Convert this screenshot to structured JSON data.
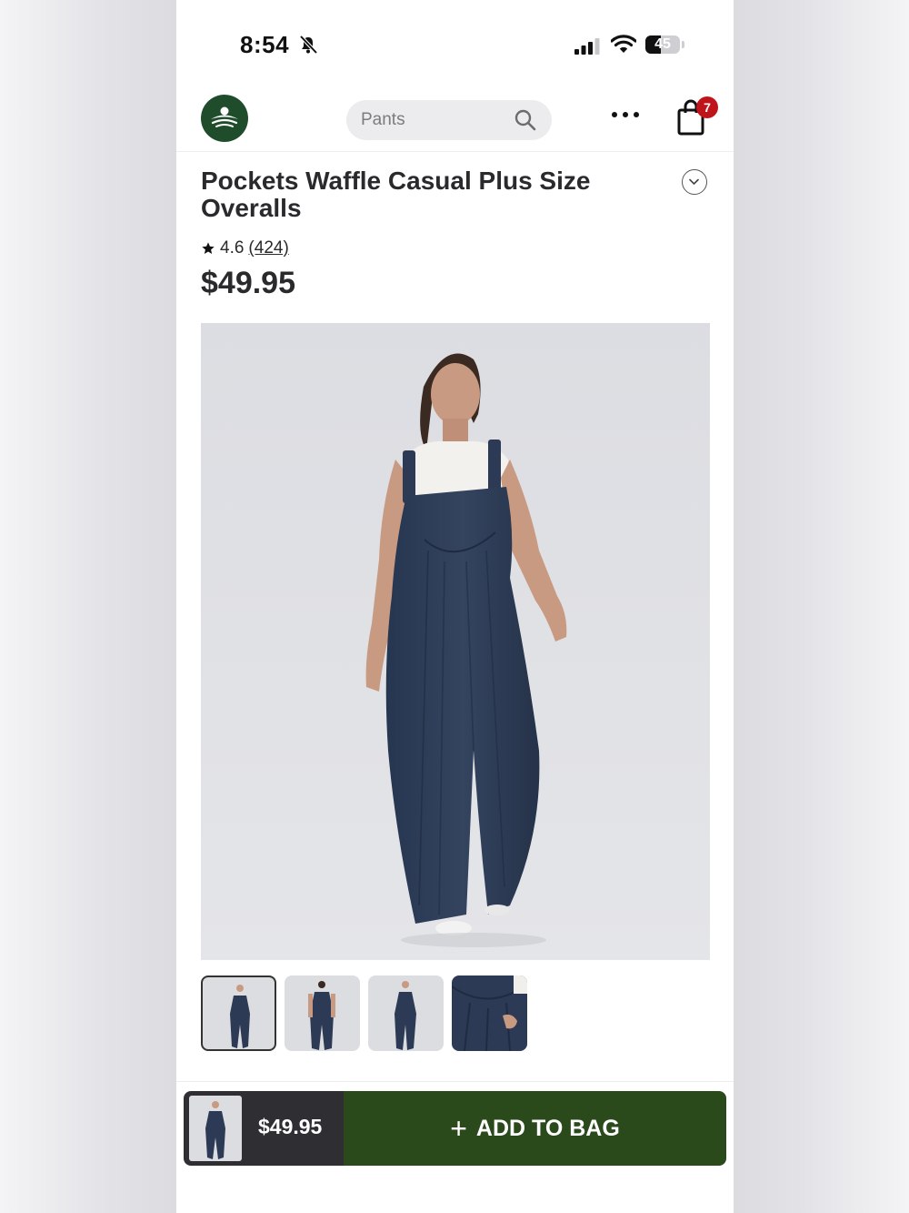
{
  "status_bar": {
    "time": "8:54",
    "battery": "45",
    "battery_level": 0.45
  },
  "header": {
    "search_placeholder": "Pants",
    "cart_count": "7"
  },
  "product": {
    "title": "Pockets Waffle Casual Plus Size Overalls",
    "rating": "4.6",
    "review_count": "(424)",
    "price": "$49.95",
    "thumbnail_count": 4,
    "selected_thumbnail": 1
  },
  "bottom_bar": {
    "price": "$49.95",
    "add_label": "ADD TO BAG",
    "add_icon": "+"
  },
  "colors": {
    "brand_green": "#1f4d2c",
    "button_green": "#2a4a1c",
    "badge_red": "#c0141b",
    "product_navy": "#2c3a55"
  },
  "icons": [
    "mute-icon",
    "signal-icon",
    "wifi-icon",
    "battery-icon",
    "logo-icon",
    "search-icon",
    "more-icon",
    "bag-icon",
    "chevron-down-icon",
    "star-icon",
    "plus-icon"
  ]
}
